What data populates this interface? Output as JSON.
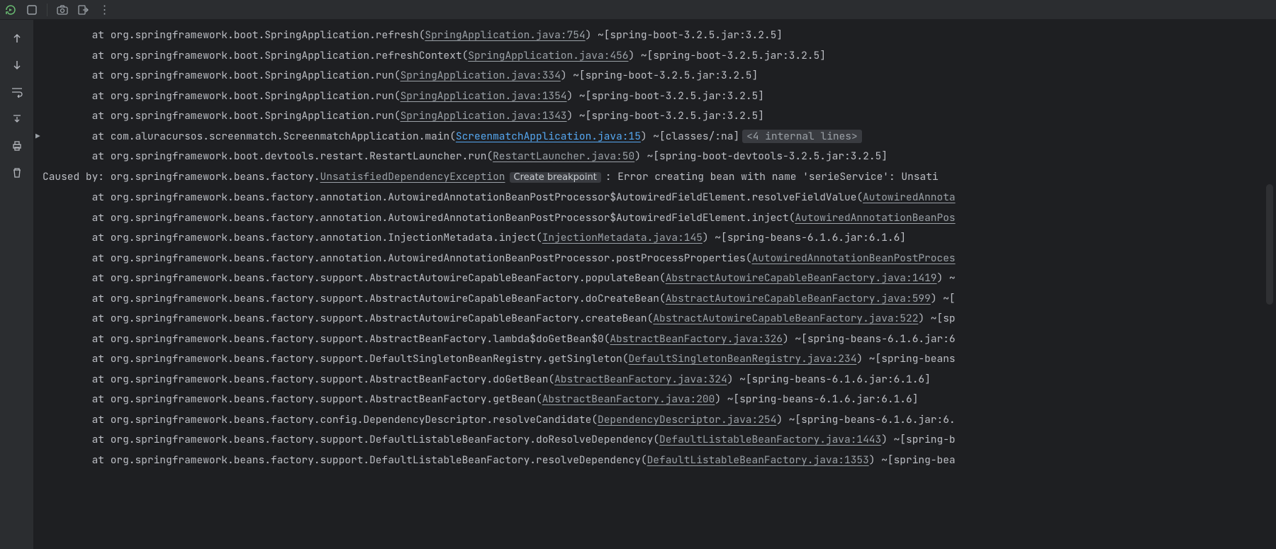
{
  "toolbar": {
    "rerun": "rerun-icon",
    "stop": "stop-icon",
    "screenshot": "camera-icon",
    "exit": "exit-icon",
    "more": "more-icon"
  },
  "gutter": {
    "up": "arrow-up-icon",
    "down": "arrow-down-icon",
    "soft_wrap": "soft-wrap-icon",
    "scroll_end": "scroll-to-end-icon",
    "print": "print-icon",
    "trash": "trash-icon"
  },
  "console": {
    "lines": [
      {
        "prefix": "        at org.springframework.boot.SpringApplication.refresh(",
        "link": "SpringApplication.java:754",
        "suffix": ") ~[spring-boot-3.2.5.jar:3.2.5]"
      },
      {
        "prefix": "        at org.springframework.boot.SpringApplication.refreshContext(",
        "link": "SpringApplication.java:456",
        "suffix": ") ~[spring-boot-3.2.5.jar:3.2.5]"
      },
      {
        "prefix": "        at org.springframework.boot.SpringApplication.run(",
        "link": "SpringApplication.java:334",
        "suffix": ") ~[spring-boot-3.2.5.jar:3.2.5]"
      },
      {
        "prefix": "        at org.springframework.boot.SpringApplication.run(",
        "link": "SpringApplication.java:1354",
        "suffix": ") ~[spring-boot-3.2.5.jar:3.2.5]"
      },
      {
        "prefix": "        at org.springframework.boot.SpringApplication.run(",
        "link": "SpringApplication.java:1343",
        "suffix": ") ~[spring-boot-3.2.5.jar:3.2.5]"
      },
      {
        "prefix": "        at com.aluracursos.screenmatch.ScreenmatchApplication.main(",
        "link": "ScreenmatchApplication.java:15",
        "link_bright": true,
        "suffix": ") ~[classes/:na]",
        "badge": "<4 internal lines>",
        "fold": true
      },
      {
        "prefix": "        at org.springframework.boot.devtools.restart.RestartLauncher.run(",
        "link": "RestartLauncher.java:50",
        "suffix": ") ~[spring-boot-devtools-3.2.5.jar:3.2.5]"
      },
      {
        "caused_prefix": "Caused by: org.springframework.beans.factory.",
        "exception": "UnsatisfiedDependencyException",
        "bp": "Create breakpoint",
        "caused_suffix": ": Error creating bean with name 'serieService': Unsati"
      },
      {
        "prefix": "        at org.springframework.beans.factory.annotation.AutowiredAnnotationBeanPostProcessor$AutowiredFieldElement.resolveFieldValue(",
        "link": "AutowiredAnnota",
        "suffix": ""
      },
      {
        "prefix": "        at org.springframework.beans.factory.annotation.AutowiredAnnotationBeanPostProcessor$AutowiredFieldElement.inject(",
        "link": "AutowiredAnnotationBeanPos",
        "suffix": ""
      },
      {
        "prefix": "        at org.springframework.beans.factory.annotation.InjectionMetadata.inject(",
        "link": "InjectionMetadata.java:145",
        "suffix": ") ~[spring-beans-6.1.6.jar:6.1.6]"
      },
      {
        "prefix": "        at org.springframework.beans.factory.annotation.AutowiredAnnotationBeanPostProcessor.postProcessProperties(",
        "link": "AutowiredAnnotationBeanPostProces",
        "suffix": ""
      },
      {
        "prefix": "        at org.springframework.beans.factory.support.AbstractAutowireCapableBeanFactory.populateBean(",
        "link": "AbstractAutowireCapableBeanFactory.java:1419",
        "suffix": ") ~"
      },
      {
        "prefix": "        at org.springframework.beans.factory.support.AbstractAutowireCapableBeanFactory.doCreateBean(",
        "link": "AbstractAutowireCapableBeanFactory.java:599",
        "suffix": ") ~["
      },
      {
        "prefix": "        at org.springframework.beans.factory.support.AbstractAutowireCapableBeanFactory.createBean(",
        "link": "AbstractAutowireCapableBeanFactory.java:522",
        "suffix": ") ~[sp"
      },
      {
        "prefix": "        at org.springframework.beans.factory.support.AbstractBeanFactory.lambda$doGetBean$0(",
        "link": "AbstractBeanFactory.java:326",
        "suffix": ") ~[spring-beans-6.1.6.jar:6"
      },
      {
        "prefix": "        at org.springframework.beans.factory.support.DefaultSingletonBeanRegistry.getSingleton(",
        "link": "DefaultSingletonBeanRegistry.java:234",
        "suffix": ") ~[spring-beans"
      },
      {
        "prefix": "        at org.springframework.beans.factory.support.AbstractBeanFactory.doGetBean(",
        "link": "AbstractBeanFactory.java:324",
        "suffix": ") ~[spring-beans-6.1.6.jar:6.1.6]"
      },
      {
        "prefix": "        at org.springframework.beans.factory.support.AbstractBeanFactory.getBean(",
        "link": "AbstractBeanFactory.java:200",
        "suffix": ") ~[spring-beans-6.1.6.jar:6.1.6]"
      },
      {
        "prefix": "        at org.springframework.beans.factory.config.DependencyDescriptor.resolveCandidate(",
        "link": "DependencyDescriptor.java:254",
        "suffix": ") ~[spring-beans-6.1.6.jar:6."
      },
      {
        "prefix": "        at org.springframework.beans.factory.support.DefaultListableBeanFactory.doResolveDependency(",
        "link": "DefaultListableBeanFactory.java:1443",
        "suffix": ") ~[spring-b"
      },
      {
        "prefix": "        at org.springframework.beans.factory.support.DefaultListableBeanFactory.resolveDependency(",
        "link": "DefaultListableBeanFactory.java:1353",
        "suffix": ") ~[spring-bea"
      }
    ]
  }
}
